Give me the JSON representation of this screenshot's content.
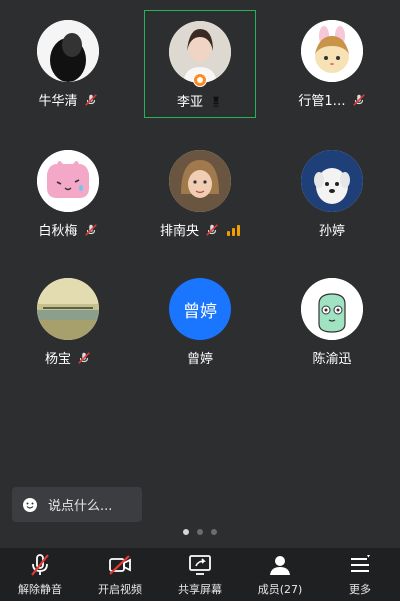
{
  "participants": [
    {
      "name": "牛华清",
      "status": "muted"
    },
    {
      "name": "李亚",
      "status": "speaking-host"
    },
    {
      "name": "行管1…",
      "status": "muted"
    },
    {
      "name": "白秋梅",
      "status": "muted"
    },
    {
      "name": "排南央",
      "status": "muted"
    },
    {
      "name": "孙婷",
      "status": "none"
    },
    {
      "name": "杨宝",
      "status": "muted"
    },
    {
      "name": "曾婷",
      "status": "none",
      "avatar_text": "曾婷"
    },
    {
      "name": "陈渝迅",
      "status": "none"
    }
  ],
  "chat": {
    "placeholder": "说点什么..."
  },
  "pagination": {
    "pages": 3,
    "current": 1
  },
  "toolbar": {
    "unmute": "解除静音",
    "video": "开启视频",
    "share": "共享屏幕",
    "members": "成员(27)",
    "more": "更多"
  },
  "colors": {
    "background": "#2c2e30",
    "active_border": "#24b25f",
    "muted_red": "#e53935",
    "host_badge": "#ff8a1e",
    "avatar_blue": "#1a75ff",
    "signal": "#f2a000"
  }
}
